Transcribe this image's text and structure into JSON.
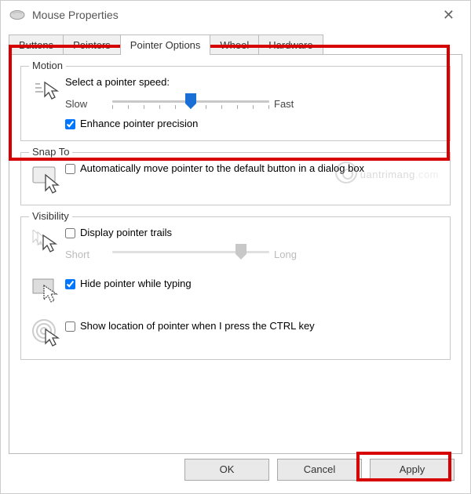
{
  "window": {
    "title": "Mouse Properties"
  },
  "tabs": {
    "buttons": "Buttons",
    "pointers": "Pointers",
    "pointer_options": "Pointer Options",
    "wheel": "Wheel",
    "hardware": "Hardware"
  },
  "motion": {
    "legend": "Motion",
    "select_label": "Select a pointer speed:",
    "slow": "Slow",
    "fast": "Fast",
    "enhance_label": "Enhance pointer precision",
    "enhance_checked": true,
    "speed_position_pct": 50
  },
  "snapto": {
    "legend": "Snap To",
    "auto_label": "Automatically move pointer to the default button in a dialog box",
    "auto_checked": false
  },
  "visibility": {
    "legend": "Visibility",
    "trails_label": "Display pointer trails",
    "trails_checked": false,
    "short": "Short",
    "long": "Long",
    "trails_position_pct": 82,
    "hide_label": "Hide pointer while typing",
    "hide_checked": true,
    "ctrl_label": "Show location of pointer when I press the CTRL key",
    "ctrl_checked": false
  },
  "buttons": {
    "ok": "OK",
    "cancel": "Cancel",
    "apply": "Apply"
  },
  "watermark": "uantrimang"
}
